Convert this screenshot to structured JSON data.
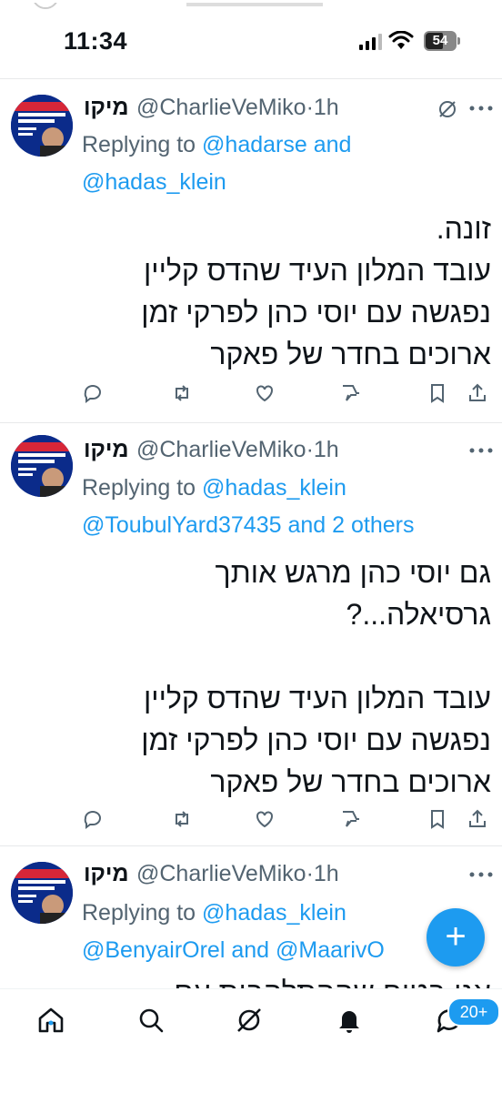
{
  "status_bar": {
    "time": "11:34",
    "battery": "54"
  },
  "tweets": [
    {
      "name": "מיקו",
      "handle": "@CharlieVeMiko",
      "time": "1h",
      "replying_prefix": "Replying to ",
      "replying_line1_mention": "@hadarse",
      "replying_line1_suffix": " and",
      "replying_line2": "@hadas_klein",
      "body": "זונה.\nעובד המלון העיד שהדס קליין\nנפגשה עם יוסי כהן לפרקי זמן\nארוכים בחדר של פאקר"
    },
    {
      "name": "מיקו",
      "handle": "@CharlieVeMiko",
      "time": "1h",
      "replying_prefix": "Replying to ",
      "replying_line1_mention": "@hadas_klein",
      "replying_line2_mention": "@ToubulYard37435",
      "replying_line2_suffix": " and 2 others",
      "body": "גם יוסי כהן מרגש אותך\nגרסיאלה...?\n\nעובד המלון העיד שהדס קליין\nנפגשה עם יוסי כהן לפרקי זמן\nארוכים בחדר של פאקר"
    },
    {
      "name": "מיקו",
      "handle": "@CharlieVeMiko",
      "time": "1h",
      "replying_prefix": "Replying to ",
      "replying_line1_mention": "@hadas_klein",
      "replying_line2_mention_a": "@BenyairOrel",
      "replying_line2_and": " and ",
      "replying_line2_mention_b": "@MaarivO",
      "body_partial": "אני בטוח שההתלהבות עם"
    }
  ],
  "fab_label": "+",
  "nav": {
    "notifications_badge": "20+"
  },
  "colors": {
    "accent": "#1d9bf0",
    "secondary_text": "#536471"
  }
}
